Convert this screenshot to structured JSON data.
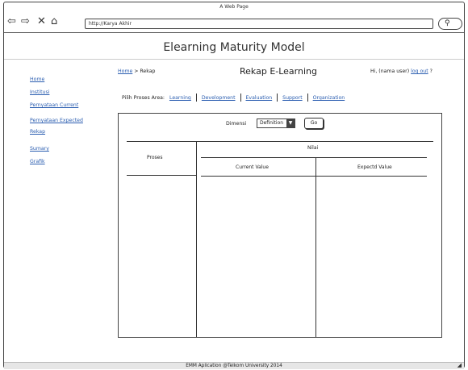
{
  "browser": {
    "title": "A Web Page",
    "url": "http://Karya Akhir",
    "icons": {
      "back": "back-arrow-icon",
      "forward": "forward-arrow-icon",
      "stop": "close-icon",
      "home": "home-icon",
      "search": "search-icon"
    }
  },
  "app": {
    "title": "Elearning Maturity Model"
  },
  "sidebar": {
    "items": [
      {
        "label": "Home"
      },
      {
        "label": "Institusi"
      },
      {
        "label": "Pernyataan Current"
      },
      {
        "label": "Pernyataan Expected"
      },
      {
        "label": "Rekap"
      },
      {
        "label": "Sumary"
      },
      {
        "label": "Grafik"
      }
    ]
  },
  "breadcrumb": {
    "home": "Home",
    "separator": ">",
    "current": "Rekap"
  },
  "page": {
    "heading": "Rekap E-Learning"
  },
  "user": {
    "greeting": "Hi, (nama user)",
    "logout": "log out",
    "help": "?"
  },
  "process_area": {
    "label": "Pilih Proses Area:",
    "links": [
      "Learning",
      "Development",
      "Evaluation",
      "Support",
      "Organization"
    ]
  },
  "filter": {
    "dimension_label": "Dimensi",
    "dimension_value": "Definition",
    "go_label": "Go"
  },
  "table": {
    "col_proses": "Proses",
    "col_nilai": "Nilai",
    "col_current": "Current Value",
    "col_expected": "Expectd Value"
  },
  "footer": {
    "text": "EMM Aplication @Telkom University 2014"
  }
}
